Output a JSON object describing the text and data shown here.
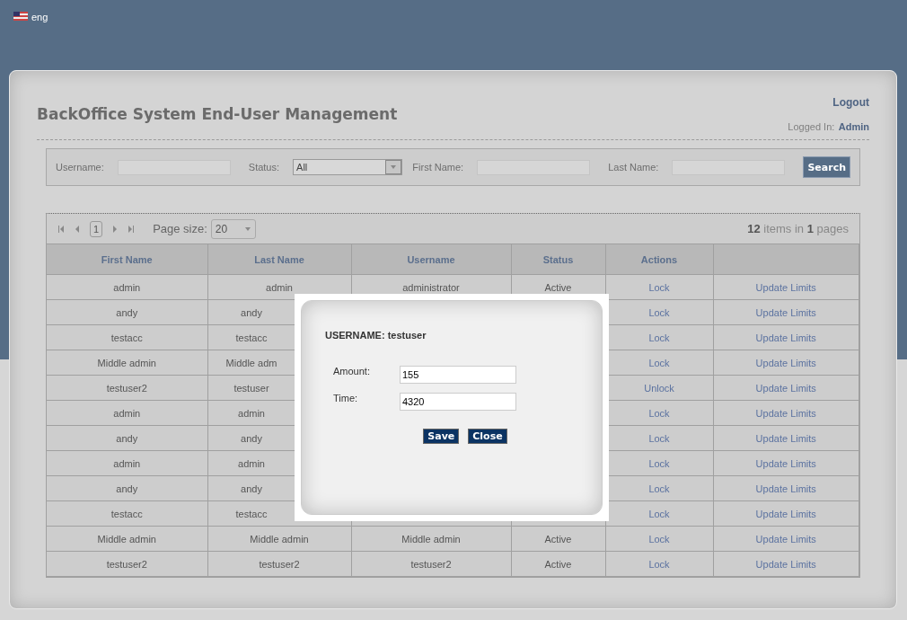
{
  "language": {
    "label": "eng"
  },
  "header": {
    "title": "BackOffice System End-User Management",
    "logout": "Logout",
    "logged_in_label": "Logged In:",
    "logged_in_user": "Admin"
  },
  "filters": [
    {
      "label": "Username:",
      "kind": "text"
    },
    {
      "label": "Status:",
      "kind": "select",
      "value": "All"
    },
    {
      "label": "First Name:",
      "kind": "text"
    },
    {
      "label": "Last Name:",
      "kind": "text"
    }
  ],
  "search_button": "Search",
  "pager": {
    "current_page": "1",
    "page_size_label": "Page size:",
    "page_size": "20",
    "summary": "**12** items in **1** pages"
  },
  "table": {
    "columns": [
      "First Name",
      "Last Name",
      "Username",
      "Status",
      "Actions"
    ],
    "rows": [
      {
        "first_name": "admin",
        "last_name": "admin",
        "username": "administrator",
        "status": "Active",
        "action": "Lock",
        "limits": "Update Limits"
      },
      {
        "first_name": "andy",
        "last_name": "andy",
        "action": "Lock",
        "limits": "Update Limits"
      },
      {
        "first_name": "testacc",
        "last_name": "testacc",
        "action": "Lock",
        "limits": "Update Limits"
      },
      {
        "first_name": "Middle admin",
        "last_name": "Middle adm",
        "action": "Lock",
        "limits": "Update Limits"
      },
      {
        "first_name": "testuser2",
        "last_name": "testuser",
        "action": "Unlock",
        "limits": "Update Limits"
      },
      {
        "first_name": "admin",
        "last_name": "admin",
        "action": "Lock",
        "limits": "Update Limits"
      },
      {
        "first_name": "andy",
        "last_name": "andy",
        "action": "Lock",
        "limits": "Update Limits"
      },
      {
        "first_name": "admin",
        "last_name": "admin",
        "action": "Lock",
        "limits": "Update Limits"
      },
      {
        "first_name": "andy",
        "last_name": "andy",
        "action": "Lock",
        "limits": "Update Limits"
      },
      {
        "first_name": "testacc",
        "last_name": "testacc",
        "action": "Lock",
        "limits": "Update Limits"
      },
      {
        "first_name": "Middle admin",
        "last_name": "Middle admin",
        "username": "Middle admin",
        "status": "Active",
        "action": "Lock",
        "limits": "Update Limits"
      },
      {
        "first_name": "testuser2",
        "last_name": "testuser2",
        "username": "testuser2",
        "status": "Active",
        "action": "Lock",
        "limits": "Update Limits"
      }
    ]
  },
  "dialog": {
    "title": "USERNAME: testuser",
    "fields": [
      {
        "label": "Amount:",
        "value": "155"
      },
      {
        "label": "Time:",
        "value": "4320"
      }
    ],
    "buttons": [
      "Save",
      "Close"
    ]
  }
}
